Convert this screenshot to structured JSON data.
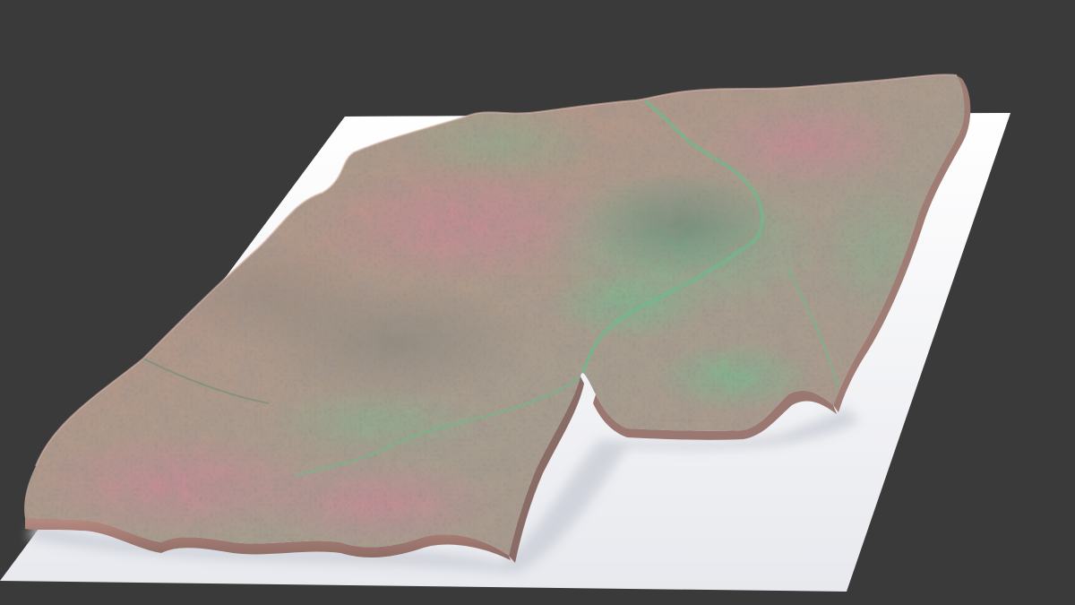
{
  "scene": {
    "background_color": "#3a3a3a",
    "base_plate_color": "#f2f2f4",
    "base_plate_shadow_color": "#d9dbe0",
    "terrain_palette": {
      "pink": "#c98a86",
      "tan": "#b99c82",
      "green": "#77b98d",
      "dark_green": "#5f8b73",
      "shadow": "#6e5a55"
    }
  }
}
